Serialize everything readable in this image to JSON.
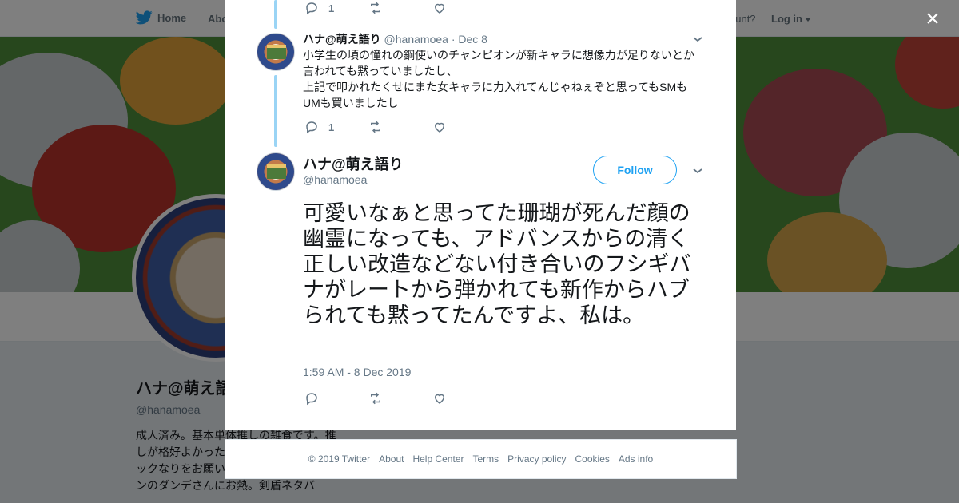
{
  "nav": {
    "home_label": "Home",
    "about_label": "Abo",
    "account_label": "ccount?",
    "login_label": "Log in"
  },
  "profile": {
    "name": "ハナ@萌え語",
    "handle": "@hanamoea",
    "bio": "成人済み。基本単体推しの雑食です。推しが格好よかったいね！しちゃうのブロックなりをお願いします。最近はポケモンのダンデさんにお熱。剣盾ネタバ"
  },
  "modal": {
    "close_label": "×",
    "top_actions": {
      "reply_count": "1",
      "retweet_count": "",
      "like_count": ""
    },
    "reply": {
      "name": "ハナ@萌え語り",
      "handle": "@hanamoea",
      "date": "· Dec 8",
      "lines": [
        "小学生の頃の憧れの鋼使いのチャンピオンが新キャラに想像力が足りないとか",
        "言われても黙っていましたし、",
        "上記で叩かれたくせにまた女キャラに力入れてんじゃねぇぞと思ってもSMも",
        "UMも買いましたし"
      ],
      "reply_count": "1"
    },
    "main": {
      "name": "ハナ@萌え語り",
      "handle": "@hanamoea",
      "follow_label": "Follow",
      "text": "可愛いなぁと思ってた珊瑚が死んだ顔の幽霊になっても、アドバンスからの清く正しい改造などない付き合いのフシギバナがレートから弾かれても新作からハブられても黙ってたんですよ、私は。",
      "timestamp": "1:59 AM - 8 Dec 2019"
    }
  },
  "footer": {
    "links": [
      "© 2019 Twitter",
      "About",
      "Help Center",
      "Terms",
      "Privacy policy",
      "Cookies",
      "Ads info"
    ]
  },
  "colors": {
    "twitter_blue": "#1da1f2",
    "thread_line": "#9ad4f5",
    "muted_text": "#657786",
    "banner_green": "#4f8f3b"
  },
  "icons": [
    "twitter-bird-icon",
    "close-icon",
    "reply-icon",
    "retweet-icon",
    "like-icon",
    "chevron-down-icon"
  ]
}
